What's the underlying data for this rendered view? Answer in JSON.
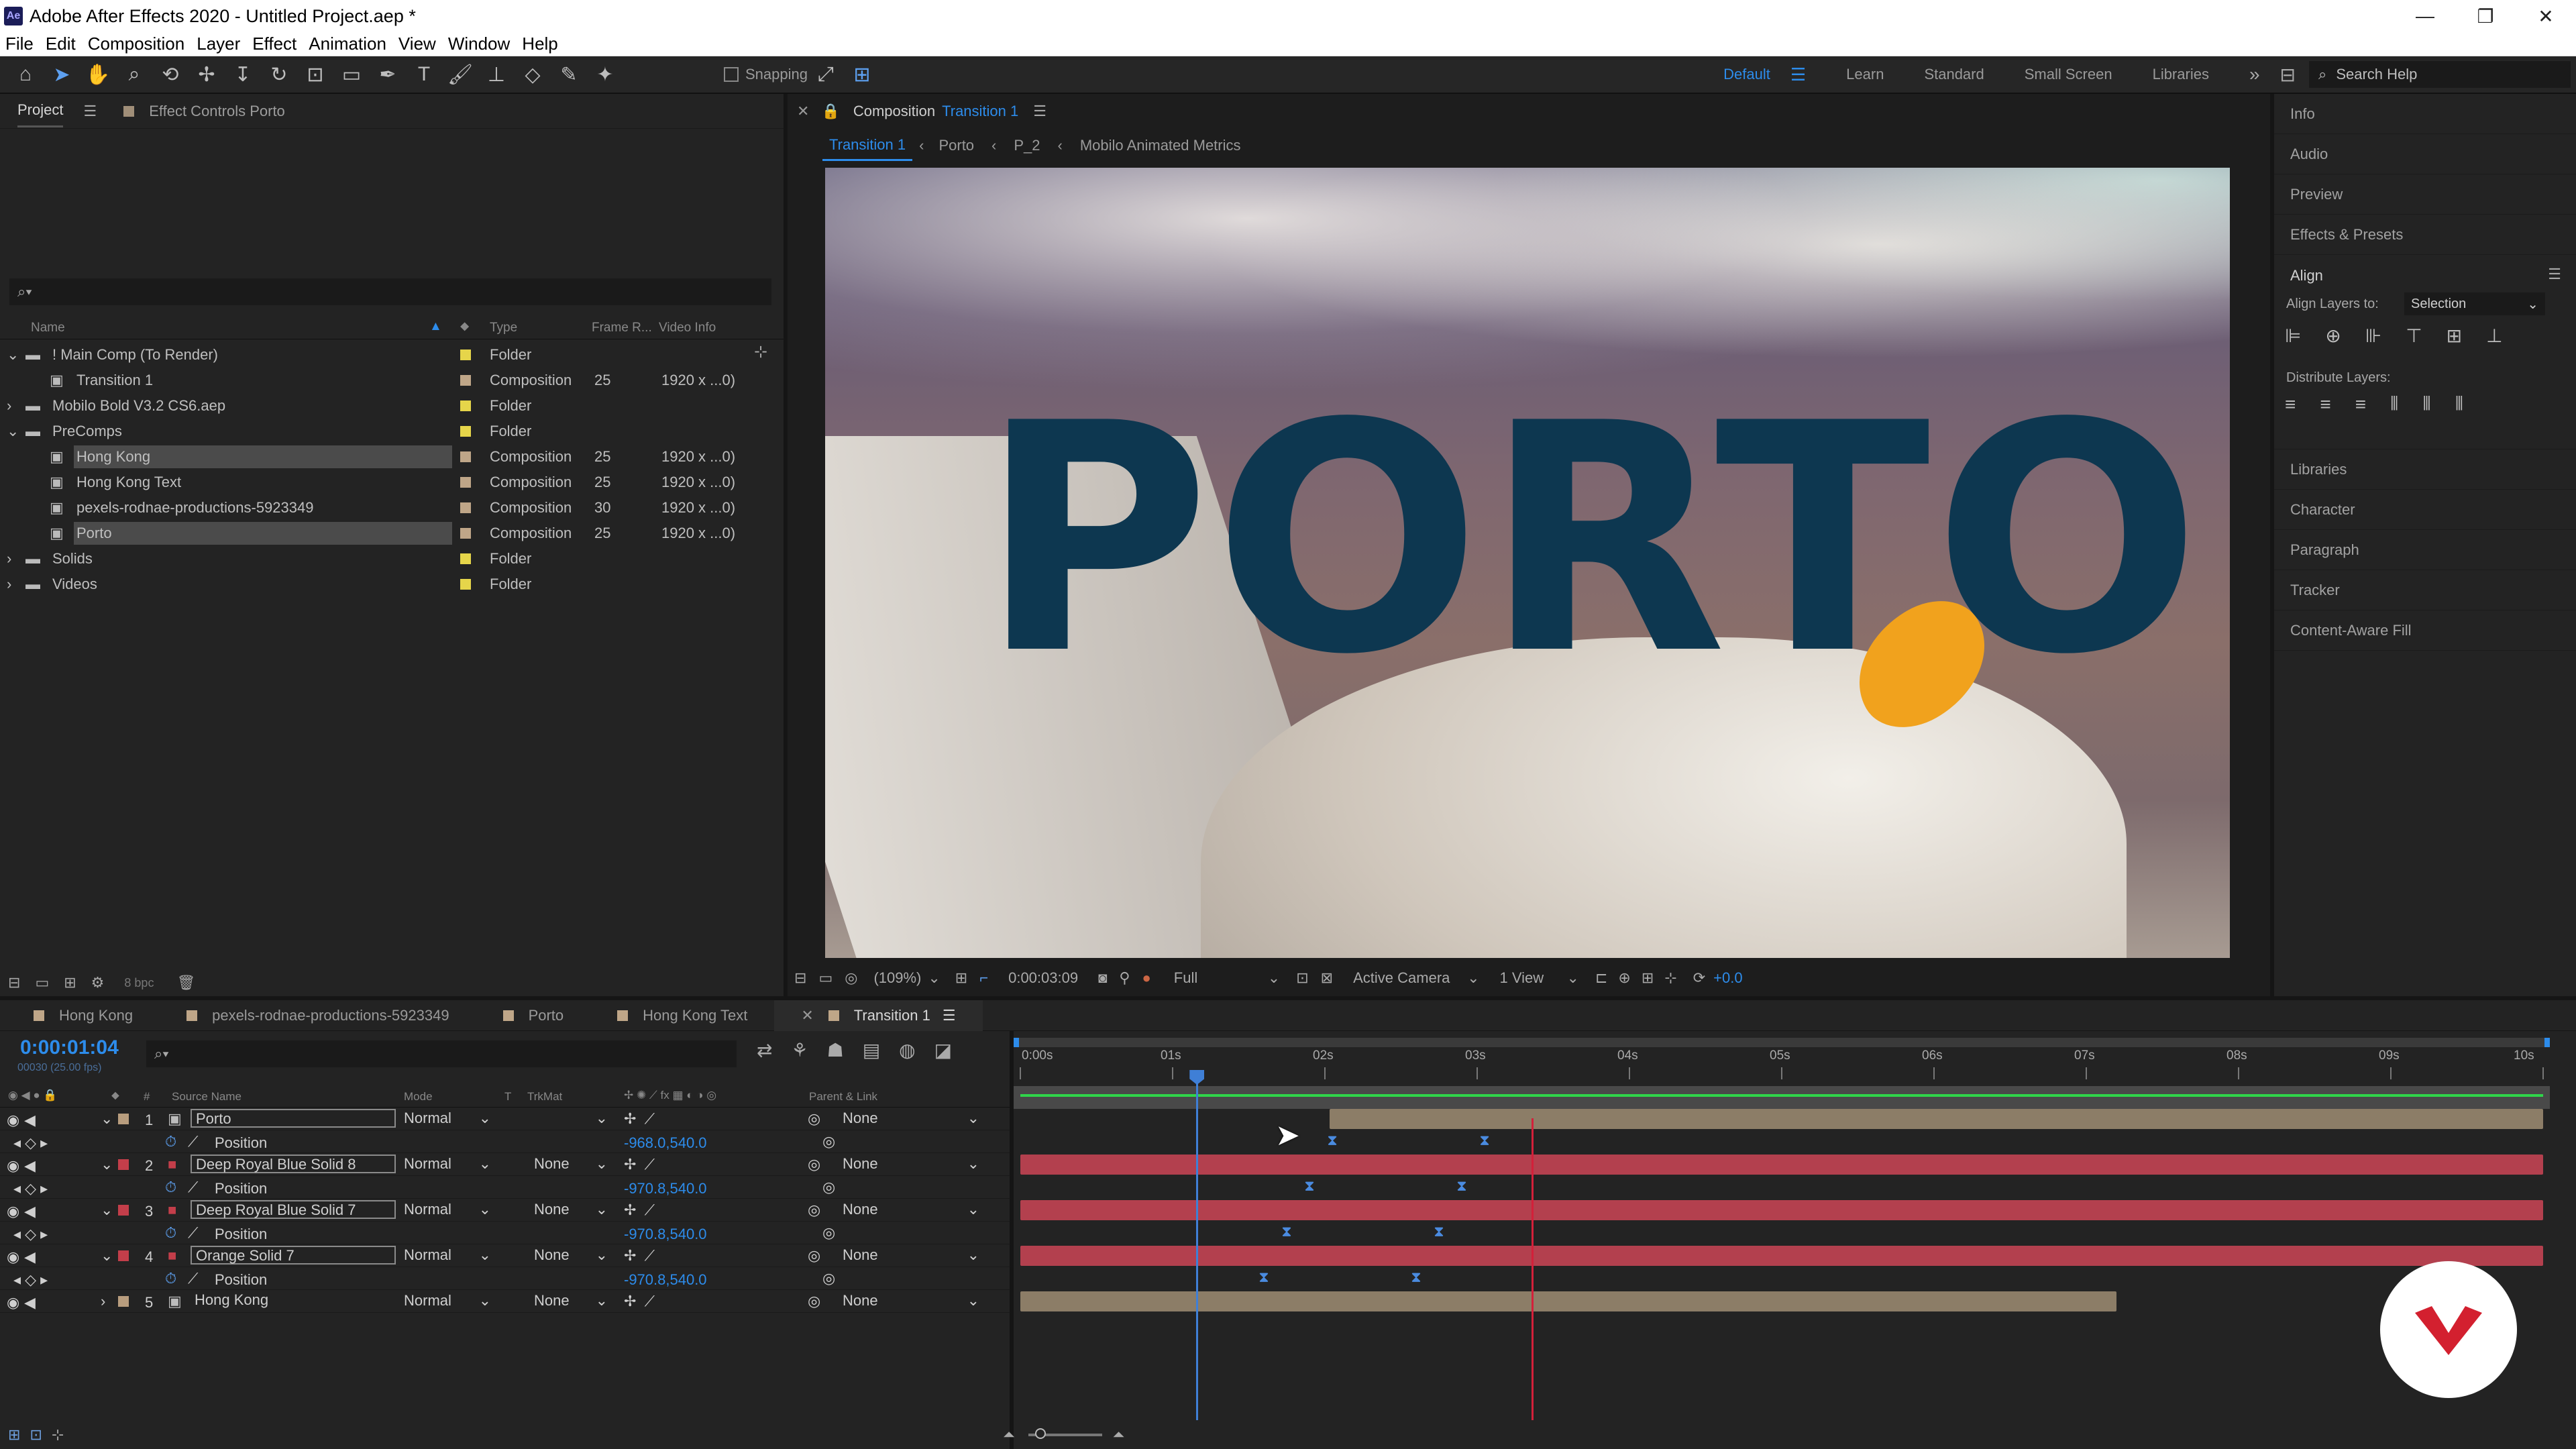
{
  "window": {
    "title": "Adobe After Effects 2020 - Untitled Project.aep *",
    "minimize": "—",
    "restore": "❐",
    "close": "✕"
  },
  "menu": [
    "File",
    "Edit",
    "Composition",
    "Layer",
    "Effect",
    "Animation",
    "View",
    "Window",
    "Help"
  ],
  "toolbar": {
    "snapping": "Snapping",
    "workspaces": [
      "Default",
      "Learn",
      "Standard",
      "Small Screen",
      "Libraries"
    ],
    "search": "Search Help"
  },
  "project": {
    "tabs": {
      "project": "Project",
      "effect_controls": "Effect Controls Porto"
    },
    "columns": {
      "name": "Name",
      "type": "Type",
      "frame_rate": "Frame R...",
      "video_info": "Video Info"
    },
    "bpc": "8 bpc",
    "rows": [
      {
        "name": "! Main Comp (To Render)",
        "type": "Folder",
        "fr": "",
        "info": "",
        "kind": "folder",
        "indent": 0,
        "open": true,
        "label": "#e6d54a",
        "sel": false
      },
      {
        "name": "Transition 1",
        "type": "Composition",
        "fr": "25",
        "info": "1920 x ...0)",
        "kind": "comp",
        "indent": 1,
        "label": "#bfa688",
        "sel": false
      },
      {
        "name": "Mobilo Bold V3.2 CS6.aep",
        "type": "Folder",
        "fr": "",
        "info": "",
        "kind": "folder",
        "indent": 0,
        "open": false,
        "label": "#e6d54a",
        "sel": false
      },
      {
        "name": "PreComps",
        "type": "Folder",
        "fr": "",
        "info": "",
        "kind": "folder",
        "indent": 0,
        "open": true,
        "label": "#e6d54a",
        "sel": false
      },
      {
        "name": "Hong Kong",
        "type": "Composition",
        "fr": "25",
        "info": "1920 x ...0)",
        "kind": "comp",
        "indent": 1,
        "label": "#bfa688",
        "sel": true
      },
      {
        "name": "Hong Kong Text",
        "type": "Composition",
        "fr": "25",
        "info": "1920 x ...0)",
        "kind": "comp",
        "indent": 1,
        "label": "#bfa688",
        "sel": false
      },
      {
        "name": "pexels-rodnae-productions-5923349",
        "type": "Composition",
        "fr": "30",
        "info": "1920 x ...0)",
        "kind": "comp",
        "indent": 1,
        "label": "#bfa688",
        "sel": false
      },
      {
        "name": "Porto",
        "type": "Composition",
        "fr": "25",
        "info": "1920 x ...0)",
        "kind": "comp",
        "indent": 1,
        "label": "#bfa688",
        "sel": true
      },
      {
        "name": "Solids",
        "type": "Folder",
        "fr": "",
        "info": "",
        "kind": "folder",
        "indent": 0,
        "open": false,
        "label": "#e6d54a",
        "sel": false
      },
      {
        "name": "Videos",
        "type": "Folder",
        "fr": "",
        "info": "",
        "kind": "folder",
        "indent": 0,
        "open": false,
        "label": "#e6d54a",
        "sel": false
      }
    ]
  },
  "composition": {
    "panel_label": "Composition",
    "comp_name": "Transition 1",
    "breadcrumbs": [
      "Transition 1",
      "Porto",
      "P_2",
      "Mobilo Animated Metrics"
    ],
    "overlay_text": "PORTO",
    "zoom": "(109%)",
    "timecode": "0:00:03:09",
    "resolution": "Full",
    "camera": "Active Camera",
    "views": "1 View",
    "exposure": "+0.0"
  },
  "right_panel": {
    "items": [
      "Info",
      "Audio",
      "Preview",
      "Effects & Presets"
    ],
    "align": {
      "title": "Align",
      "align_to_label": "Align Layers to:",
      "align_to_value": "Selection",
      "distribute_label": "Distribute Layers:"
    },
    "items2": [
      "Libraries",
      "Character",
      "Paragraph",
      "Tracker",
      "Content-Aware Fill"
    ]
  },
  "timeline": {
    "tabs": [
      "Hong Kong",
      "pexels-rodnae-productions-5923349",
      "Porto",
      "Hong Kong Text",
      "Transition 1"
    ],
    "active_tab": "Transition 1",
    "timecode": "0:00:01:04",
    "timecode_sub": "00030 (25.00 fps)",
    "columns": {
      "source": "Source Name",
      "mode": "Mode",
      "t": "T",
      "trkmat": "TrkMat",
      "parent": "Parent & Link"
    },
    "ruler": [
      "0:00s",
      "01s",
      "02s",
      "03s",
      "04s",
      "05s",
      "06s",
      "07s",
      "08s",
      "09s",
      "10s"
    ],
    "duration_s": 10,
    "current_time_s": 1.16,
    "work_marker_s": 3.36,
    "layers": [
      {
        "num": "1",
        "name": "Porto",
        "mode": "Normal",
        "trkmat": "",
        "parent": "None",
        "label": "#b89d7e",
        "kind": "comp",
        "pos": "-968.0,540.0",
        "bar_color": "#8c7d67",
        "bar_start_s": 2.03,
        "bar_end_s": 10,
        "keys_s": [
          2.05,
          3.05
        ]
      },
      {
        "num": "2",
        "name": "Deep Royal Blue Solid 8",
        "mode": "Normal",
        "trkmat": "None",
        "parent": "None",
        "label": "#c33e4a",
        "kind": "solid",
        "pos": "-970.8,540.0",
        "bar_color": "#b3404e",
        "bar_start_s": 0,
        "bar_end_s": 10,
        "keys_s": [
          1.9,
          2.9
        ]
      },
      {
        "num": "3",
        "name": "Deep Royal Blue Solid 7",
        "mode": "Normal",
        "trkmat": "None",
        "parent": "None",
        "label": "#c33e4a",
        "kind": "solid",
        "pos": "-970.8,540.0",
        "bar_color": "#b3404e",
        "bar_start_s": 0,
        "bar_end_s": 10,
        "keys_s": [
          1.75,
          2.75
        ]
      },
      {
        "num": "4",
        "name": "Orange Solid 7",
        "mode": "Normal",
        "trkmat": "None",
        "parent": "None",
        "label": "#c33e4a",
        "kind": "solid",
        "pos": "-970.8,540.0",
        "bar_color": "#b3404e",
        "bar_start_s": 0,
        "bar_end_s": 10,
        "keys_s": [
          1.6,
          2.6
        ]
      },
      {
        "num": "5",
        "name": "Hong Kong",
        "mode": "Normal",
        "trkmat": "None",
        "parent": "None",
        "label": "#b89d7e",
        "kind": "comp",
        "pos": "",
        "bar_color": "#8c7d67",
        "bar_start_s": 0,
        "bar_end_s": 7.2,
        "keys_s": []
      }
    ],
    "property_label": "Position"
  },
  "colors": {
    "accent": "#2d8ceb",
    "playhead": "#3f7fd6",
    "work_line": "#d3203a"
  }
}
